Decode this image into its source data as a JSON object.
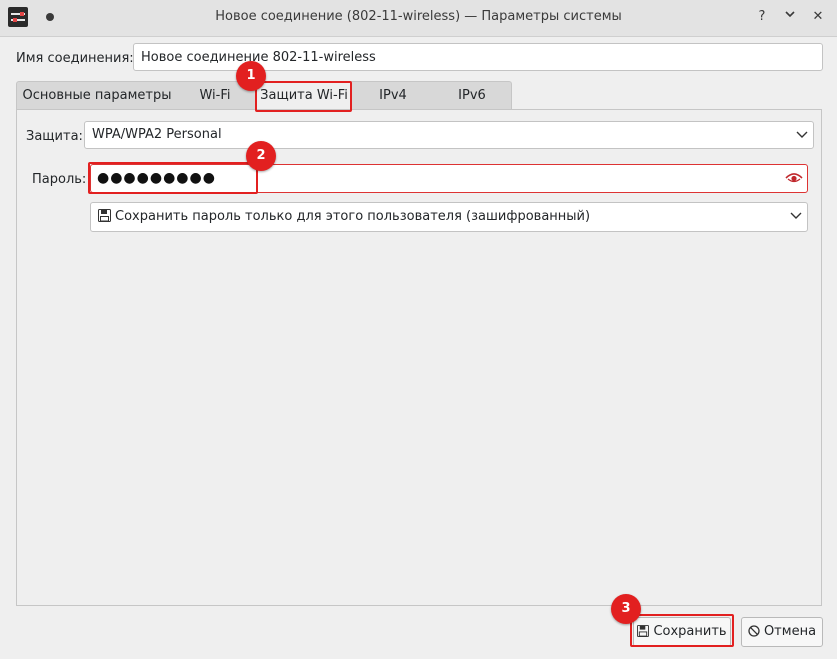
{
  "window": {
    "title": "Новое соединение (802-11-wireless) — Параметры системы",
    "buttons": {
      "help": "?",
      "minimize": "⌄",
      "close": "✕"
    }
  },
  "connection_name": {
    "label": "Имя соединения:",
    "value": "Новое соединение 802-11-wireless"
  },
  "tabs": [
    {
      "label": "Основные параметры"
    },
    {
      "label": "Wi-Fi"
    },
    {
      "label": "Защита Wi-Fi",
      "active": true
    },
    {
      "label": "IPv4"
    },
    {
      "label": "IPv6"
    }
  ],
  "security": {
    "label": "Защита:",
    "value": "WPA/WPA2 Personal"
  },
  "password": {
    "label": "Пароль:",
    "value": "●●●●●●●●●",
    "storage": "Сохранить пароль только для этого пользователя (зашифрованный)"
  },
  "buttons": {
    "save": "Сохранить",
    "cancel": "Отмена"
  },
  "annotations": [
    "1",
    "2",
    "3"
  ],
  "icons": {
    "app": "network-settings-icon",
    "eye": "show-password-icon",
    "floppy": "save-icon",
    "cancel": "cancel-icon",
    "chevron": "chevron-down-icon"
  },
  "colors": {
    "highlight": "#e22020",
    "window_bg": "#efefef"
  }
}
